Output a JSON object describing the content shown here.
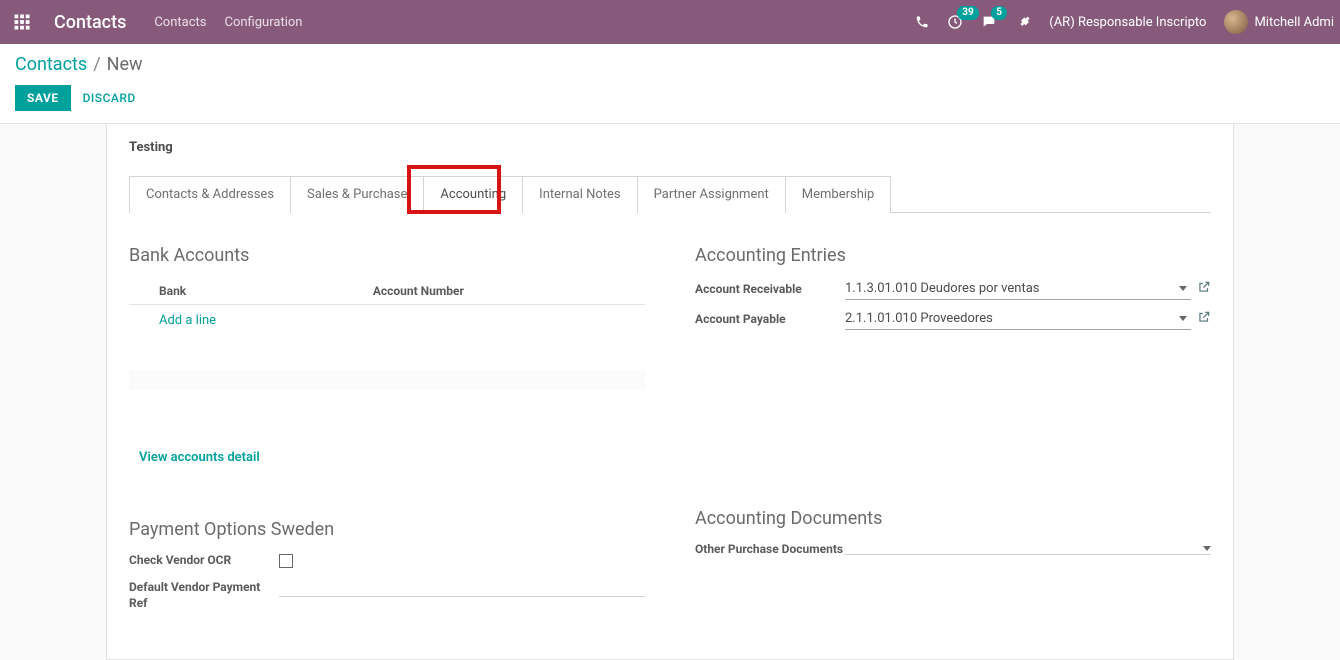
{
  "header": {
    "brand": "Contacts",
    "nav": [
      "Contacts",
      "Configuration"
    ],
    "activity_badge": "39",
    "chat_badge": "5",
    "company": "(AR) Responsable Inscripto",
    "user": "Mitchell Admi"
  },
  "breadcrumb": {
    "root": "Contacts",
    "current": "New"
  },
  "buttons": {
    "save": "Save",
    "discard": "Discard"
  },
  "partner_name": "Testing",
  "tabs": [
    {
      "label": "Contacts & Addresses",
      "active": false
    },
    {
      "label": "Sales & Purchase",
      "active": false
    },
    {
      "label": "Accounting",
      "active": true
    },
    {
      "label": "Internal Notes",
      "active": false
    },
    {
      "label": "Partner Assignment",
      "active": false
    },
    {
      "label": "Membership",
      "active": false
    }
  ],
  "bank": {
    "title": "Bank Accounts",
    "col_bank": "Bank",
    "col_number": "Account Number",
    "add_line": "Add a line",
    "view_detail": "View accounts detail"
  },
  "entries": {
    "title": "Accounting Entries",
    "ar_label": "Account Receivable",
    "ar_value": "1.1.3.01.010 Deudores por ventas",
    "ap_label": "Account Payable",
    "ap_value": "2.1.1.01.010 Proveedores"
  },
  "payment": {
    "title": "Payment Options Sweden",
    "check_ocr": "Check Vendor OCR",
    "def_ref": "Default Vendor Payment Ref"
  },
  "docs": {
    "title": "Accounting Documents",
    "other_label": "Other Purchase Documents"
  }
}
